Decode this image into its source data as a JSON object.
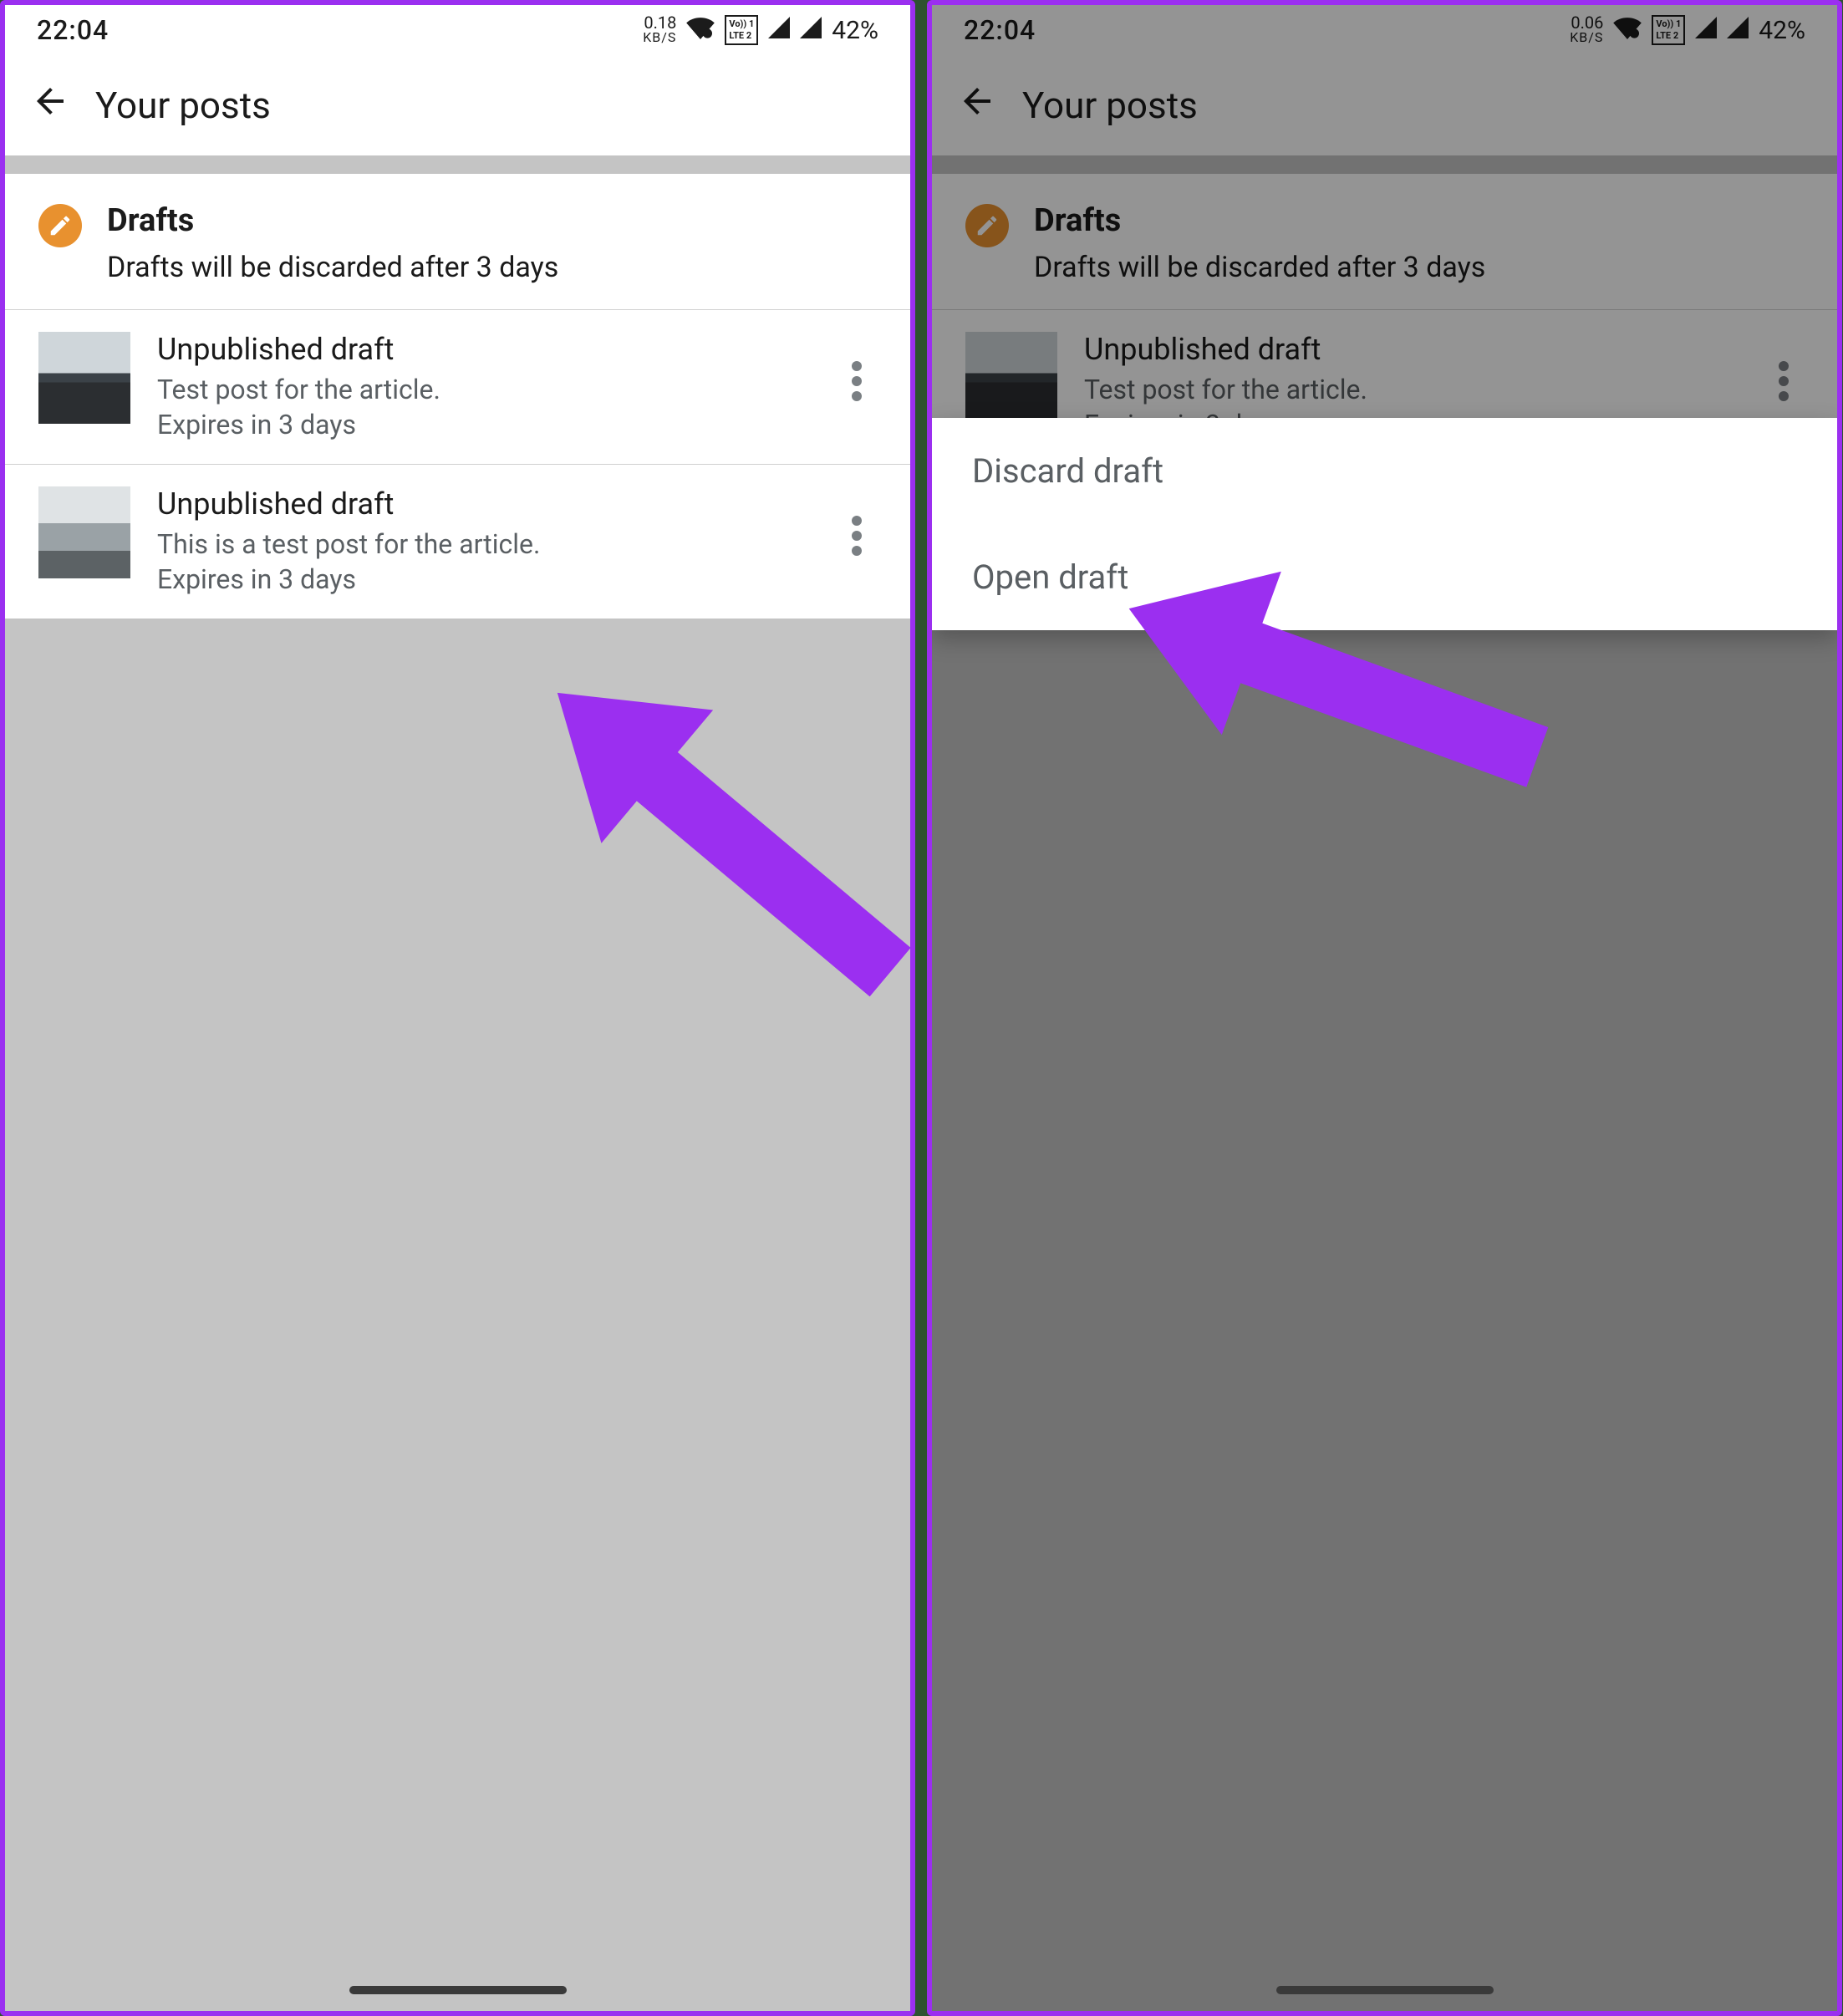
{
  "status": {
    "time": "22:04",
    "kbs_left": "0.18",
    "kbs_left_unit": "KB/S",
    "kbs_right": "0.06",
    "kbs_right_unit": "KB/S",
    "lte_top": "Vo)) 1",
    "lte_bottom": "LTE 2",
    "battery": "42%"
  },
  "toolbar": {
    "title": "Your posts"
  },
  "drafts_header": {
    "title": "Drafts",
    "subtitle": "Drafts will be discarded after 3 days"
  },
  "drafts": [
    {
      "title": "Unpublished draft",
      "desc": "Test post for the article.",
      "expires": "Expires in 3 days"
    },
    {
      "title": "Unpublished draft",
      "desc": "This is a test post for the article.",
      "expires": "Expires in 3 days"
    }
  ],
  "popup": {
    "discard": "Discard draft",
    "open": "Open draft"
  }
}
